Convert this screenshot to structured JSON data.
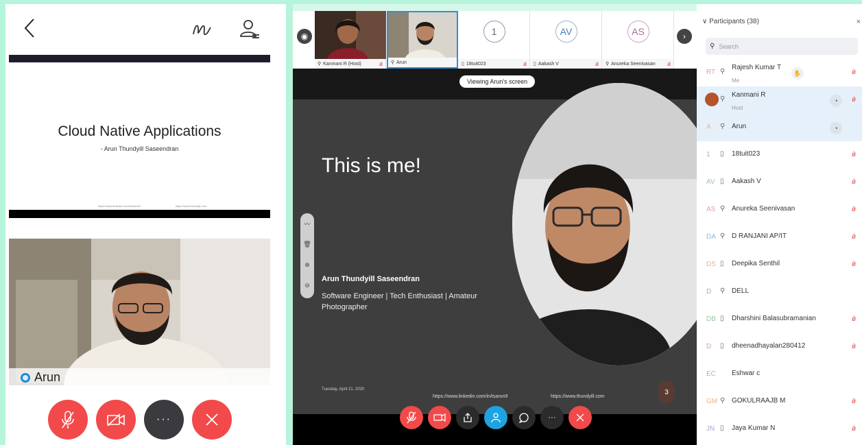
{
  "left_panel": {
    "slide_title": "Cloud Native Applications",
    "slide_subtitle": "- Arun Thundyill Saseendran",
    "slide_link_1": "https://www.linkedin.com/in/tsarun9",
    "slide_link_2": "https://www.thundyill.com",
    "video_name": "Arun"
  },
  "meeting": {
    "thumbnails": [
      {
        "label": "Kanmani R (Host)"
      },
      {
        "label": "Arun"
      },
      {
        "label": "18tuit023",
        "initials": "1"
      },
      {
        "label": "Aakash V",
        "initials": "AV"
      },
      {
        "label": "Anureka Seenivasan",
        "initials": "AS"
      }
    ],
    "viewing_label": "Viewing Arun's screen",
    "slide": {
      "title": "This is me!",
      "name": "Arun Thundyill Saseendran",
      "description": "Software Engineer | Tech Enthusiast | Amateur Photographer",
      "date": "Tuesday, April 21, 2020",
      "link_1": "https://www.linkedin.com/in/tsarun9",
      "link_2": "https://www.thundyill.com",
      "page": "3"
    }
  },
  "participants": {
    "header": "Participants (38)",
    "close": "×",
    "search_placeholder": "Search",
    "rows": [
      {
        "initials": "RT",
        "device": "mic",
        "name": "Rajesh Kumar  T",
        "sub": "Me",
        "hand": true,
        "muted": true
      },
      {
        "initials": "",
        "device": "mic",
        "name": "Kanmani R",
        "sub": "Host",
        "chip": true,
        "muted": true,
        "photo": true,
        "highlight": true
      },
      {
        "initials": "A",
        "device": "mic",
        "name": "Arun",
        "sub": "",
        "chip": true,
        "muted": false,
        "highlight": true
      },
      {
        "initials": "1",
        "device": "phone",
        "name": "18tuit023",
        "sub": "",
        "muted": true
      },
      {
        "initials": "AV",
        "device": "phone",
        "name": "Aakash V",
        "sub": "",
        "muted": true
      },
      {
        "initials": "AS",
        "device": "mic",
        "name": "Anureka Seenivasan",
        "sub": "",
        "muted": true
      },
      {
        "initials": "DA",
        "device": "mic",
        "name": "D RANJANI AP/IT",
        "sub": "",
        "muted": true
      },
      {
        "initials": "DS",
        "device": "phone",
        "name": "Deepika Senthil",
        "sub": "",
        "muted": true
      },
      {
        "initials": "D",
        "device": "mic",
        "name": "DELL",
        "sub": "",
        "muted": false
      },
      {
        "initials": "DB",
        "device": "phone",
        "name": "Dharshini Balasubramanian",
        "sub": "",
        "muted": true
      },
      {
        "initials": "D",
        "device": "phone",
        "name": "dheenadhayalan280412",
        "sub": "",
        "muted": true
      },
      {
        "initials": "EC",
        "device": "",
        "name": "Eshwar c",
        "sub": "",
        "muted": false
      },
      {
        "initials": "GM",
        "device": "mic",
        "name": "GOKULRAAJB M",
        "sub": "",
        "muted": true
      },
      {
        "initials": "JN",
        "device": "phone",
        "name": "Jaya Kumar N",
        "sub": "",
        "muted": true
      }
    ]
  }
}
